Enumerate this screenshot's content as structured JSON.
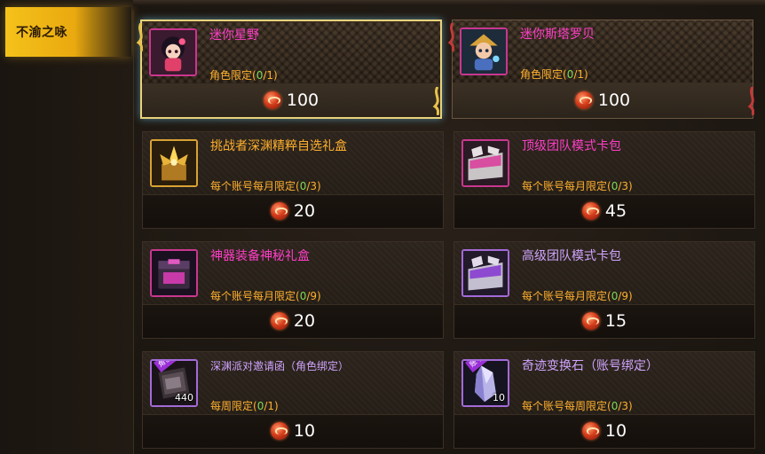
{
  "sidebar": {
    "category_label": "不渝之咏"
  },
  "colors": {
    "coin": "#d63d1c",
    "name_pink": "#ff3ec8",
    "name_orange": "#ffb02e",
    "limit_current": "#7ed957",
    "featured_border": "#e9d27a"
  },
  "items": [
    {
      "name": "迷你星野",
      "limit_prefix": "角色限定(",
      "limit_current": "0",
      "limit_total": "/1)",
      "price": "100",
      "icon": "mini-hoshino-portrait-icon"
    },
    {
      "name": "迷你斯塔罗贝",
      "limit_prefix": "角色限定(",
      "limit_current": "0",
      "limit_total": "/1)",
      "price": "100",
      "icon": "mini-starobe-portrait-icon"
    },
    {
      "name": "挑战者深渊精粹自选礼盒",
      "limit_prefix": "每个账号每月限定(",
      "limit_current": "0",
      "limit_total": "/3)",
      "price": "20",
      "icon": "golden-gift-box-icon"
    },
    {
      "name": "顶级团队模式卡包",
      "limit_prefix": "每个账号每月限定(",
      "limit_current": "0",
      "limit_total": "/3)",
      "price": "45",
      "icon": "card-pack-icon"
    },
    {
      "name": "神器装备神秘礼盒",
      "limit_prefix": "每个账号每月限定(",
      "limit_current": "0",
      "limit_total": "/9)",
      "price": "20",
      "icon": "mystery-box-icon"
    },
    {
      "name": "高级团队模式卡包",
      "limit_prefix": "每个账号每月限定(",
      "limit_current": "0",
      "limit_total": "/9)",
      "price": "15",
      "icon": "card-pack-icon"
    },
    {
      "name": "深渊派对邀请函（角色绑定）",
      "limit_prefix": "每周限定(",
      "limit_current": "0",
      "limit_total": "/1)",
      "price": "10",
      "icon": "invitation-ticket-icon",
      "badge": "角色",
      "quantity": "440"
    },
    {
      "name": "奇迹变换石（账号绑定）",
      "limit_prefix": "每个账号每周限定(",
      "limit_current": "0",
      "limit_total": "/3)",
      "price": "10",
      "icon": "crystal-stone-icon",
      "badge": "账号",
      "quantity": "10"
    }
  ]
}
